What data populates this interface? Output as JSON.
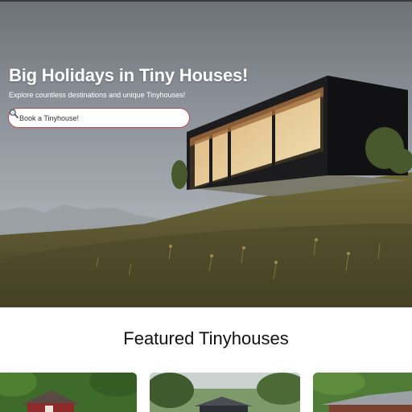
{
  "hero": {
    "title": "Big Holidays in Tiny Houses!",
    "subtitle": "Explore countless destinations and unique Tinyhouses!",
    "search": {
      "placeholder": "Book a Tinyhouse!",
      "icon": "magnifier-icon"
    }
  },
  "featured": {
    "title": "Featured Tinyhouses",
    "cards": [
      {
        "image": "red-cabin-in-forest"
      },
      {
        "image": "dark-cabin-in-trees"
      },
      {
        "image": "cabin-with-metal-roof"
      }
    ]
  },
  "colors": {
    "search_border": "#b84855",
    "page_background": "#ffffff",
    "heading_text": "#111111"
  }
}
